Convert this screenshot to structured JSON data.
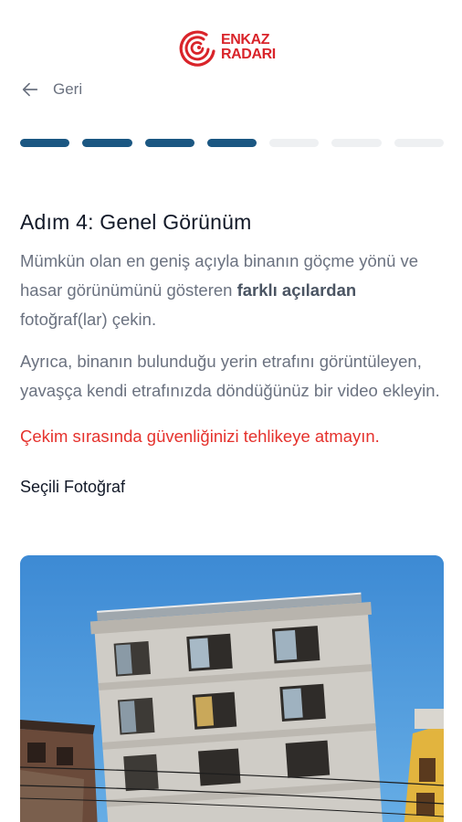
{
  "app": {
    "logo_line1": "ENKAZ",
    "logo_line2": "RADARI",
    "brand_color": "#d9242a"
  },
  "nav": {
    "back_label": "Geri",
    "back_icon": "arrow-left-icon"
  },
  "progress": {
    "total_steps": 7,
    "completed_steps": 4,
    "active_color": "#1b5782",
    "inactive_color": "#eef0f2"
  },
  "step": {
    "title": "Adım 4: Genel Görünüm",
    "para1_before": "Mümkün olan en geniş açıyla binanın göçme yönü ve hasar görünümünü gösteren ",
    "para1_bold": "farklı açılardan",
    "para1_after": " fotoğraf(lar) çekin.",
    "para2": "Ayrıca, binanın bulunduğu yerin etrafını görüntüleyen, yavaşça kendi etrafınızda döndüğünüz bir video ekleyin.",
    "warning": "Çekim sırasında güvenliğinizi tehlikeye atmayın.",
    "warning_color": "#e5322d"
  },
  "selected": {
    "label": "Seçili Fotoğraf"
  }
}
